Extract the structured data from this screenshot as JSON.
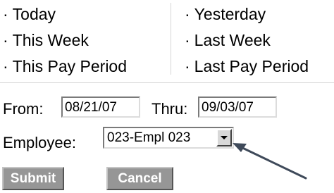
{
  "period_links": {
    "today": "Today",
    "this_week": "This Week",
    "this_pay_period": "This Pay Period",
    "yesterday": "Yesterday",
    "last_week": "Last Week",
    "last_pay_period": "Last Pay Period",
    "bullet": "·"
  },
  "date_range": {
    "from_label": "From:",
    "from_value": "08/21/07",
    "thru_label": "Thru:",
    "thru_value": "09/03/07"
  },
  "employee": {
    "label": "Employee:",
    "selected": "023-Empl 023"
  },
  "actions": {
    "submit_label": "Submit",
    "cancel_label": "Cancel"
  },
  "colors": {
    "button_bg": "#969696",
    "divider": "#d6d6d6",
    "annotation_arrow": "#3f4a5a"
  }
}
